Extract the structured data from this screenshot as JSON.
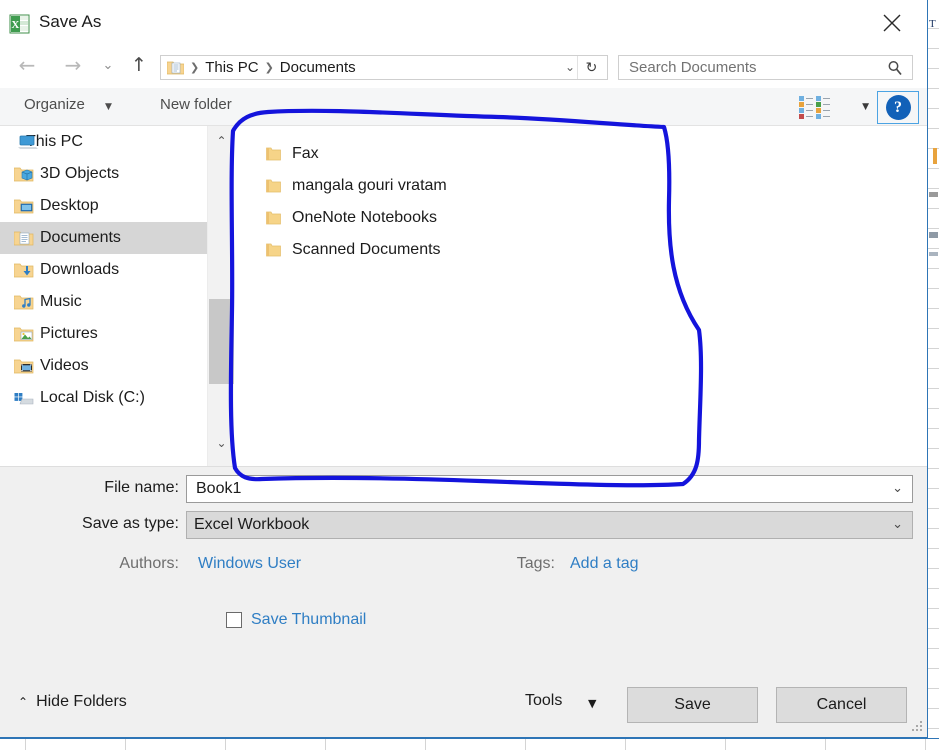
{
  "window": {
    "title": "Save As",
    "app_icon": "excel-icon",
    "close_label": "✕"
  },
  "nav": {
    "back_icon": "←",
    "forward_icon": "→",
    "history_icon": "⌄",
    "up_icon": "↑",
    "breadcrumb": [
      "This PC",
      "Documents"
    ],
    "breadcrumb_sep": "❯",
    "dropdown_icon": "⌄",
    "refresh_icon": "↻"
  },
  "search": {
    "placeholder": "Search Documents",
    "value": "",
    "icon": "search-icon"
  },
  "toolbar": {
    "organize_label": "Organize",
    "organize_caret": "▼",
    "new_folder_label": "New folder",
    "view_caret": "▼",
    "help_label": "?"
  },
  "sidebar": {
    "items": [
      {
        "label": "This PC",
        "icon": "computer-icon",
        "selected": false
      },
      {
        "label": "3D Objects",
        "icon": "folder-3d-icon",
        "selected": false
      },
      {
        "label": "Desktop",
        "icon": "folder-desktop-icon",
        "selected": false
      },
      {
        "label": "Documents",
        "icon": "folder-documents-icon",
        "selected": true
      },
      {
        "label": "Downloads",
        "icon": "folder-downloads-icon",
        "selected": false
      },
      {
        "label": "Music",
        "icon": "folder-music-icon",
        "selected": false
      },
      {
        "label": "Pictures",
        "icon": "folder-pictures-icon",
        "selected": false
      },
      {
        "label": "Videos",
        "icon": "folder-videos-icon",
        "selected": false
      },
      {
        "label": "Local Disk (C:)",
        "icon": "drive-icon",
        "selected": false
      }
    ],
    "scroll_up_icon": "⌃",
    "scroll_down_icon": "⌄"
  },
  "filelist": {
    "items": [
      {
        "name": "Fax",
        "icon": "folder-icon"
      },
      {
        "name": "mangala gouri vratam",
        "icon": "folder-icon"
      },
      {
        "name": "OneNote Notebooks",
        "icon": "folder-icon"
      },
      {
        "name": "Scanned Documents",
        "icon": "folder-icon"
      }
    ]
  },
  "form": {
    "filename_label": "File name:",
    "filename_value": "Book1",
    "savetype_label": "Save as type:",
    "savetype_value": "Excel Workbook",
    "authors_label": "Authors:",
    "authors_value": "Windows User",
    "tags_label": "Tags:",
    "tags_value": "Add a tag",
    "thumbnail_label": "Save Thumbnail",
    "thumbnail_checked": false,
    "combo_chevron": "⌄"
  },
  "footer": {
    "hide_folders_label": "Hide Folders",
    "hide_folders_caret": "⌃",
    "tools_label": "Tools",
    "tools_caret": "▼",
    "save_label": "Save",
    "cancel_label": "Cancel"
  },
  "colors": {
    "accent_blue": "#2e75b6",
    "link_blue": "#2f7ec4",
    "annotation_blue": "#1414dc",
    "folder_yellow": "#f6d488",
    "selected_gray": "#d6d6d6",
    "help_blue": "#1261b8"
  },
  "annotation": {
    "shape": "hand-drawn-rectangle",
    "color": "#1414dc"
  }
}
